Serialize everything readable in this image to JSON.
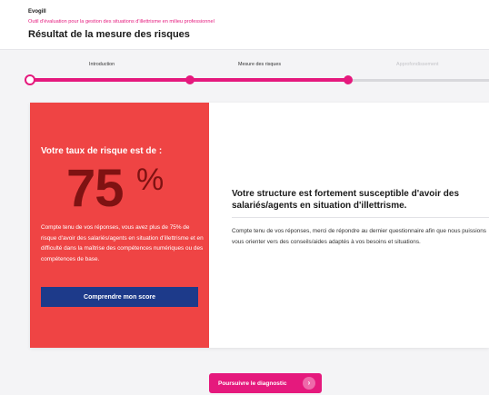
{
  "header": {
    "brand": "Evogill",
    "subtitle": "Outil d'évaluation pour la gestion des situations d'illettrisme en milieu professionnel",
    "title": "Résultat de la mesure des risques"
  },
  "stepper": {
    "steps": [
      {
        "label": "Introduction",
        "state": "done"
      },
      {
        "label": "Mesure des risques",
        "state": "done"
      },
      {
        "label": "Approfondissement",
        "state": "upcoming"
      }
    ],
    "progress_fraction": 0.69
  },
  "risk": {
    "heading": "Votre taux de risque est de :",
    "value": "75",
    "unit": "%",
    "description": "Compte tenu de vos réponses, vous avez plus de 75% de risque d'avoir des salariés/agents en situation d'illettrisme et en difficulté dans la maîtrise des compétences numériques ou des compétences de base.",
    "button_label": "Comprendre mon score",
    "panel_color": "#ef4444"
  },
  "result": {
    "title": "Votre structure est fortement susceptible d'avoir des salariés/agents en situation d'illettrisme.",
    "body": "Compte tenu de vos réponses, merci de répondre au dernier questionnaire afin que nous puissions vous orienter vers des conseils/aides adaptés à vos besoins et situations."
  },
  "footer": {
    "continue_label": "Poursuivre le diagnostic",
    "continue_icon": "arrow-right-icon",
    "accent_color": "#e5197d"
  }
}
